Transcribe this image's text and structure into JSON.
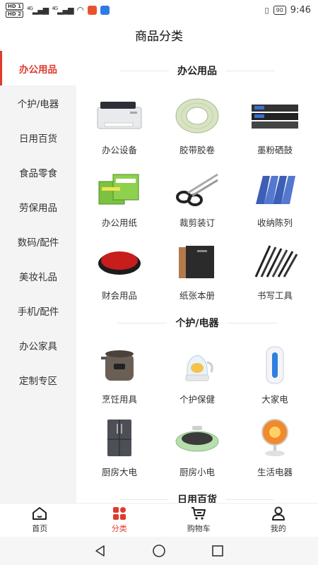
{
  "status": {
    "hd1": "HD 1",
    "hd2": "HD 2",
    "signal1": "4G",
    "signal2": "4G",
    "battery": "90",
    "time": "9:46"
  },
  "header": {
    "title": "商品分类"
  },
  "sidebar": {
    "items": [
      {
        "label": "办公用品"
      },
      {
        "label": "个护/电器"
      },
      {
        "label": "日用百货"
      },
      {
        "label": "食品零食"
      },
      {
        "label": "劳保用品"
      },
      {
        "label": "数码/配件"
      },
      {
        "label": "美妆礼品"
      },
      {
        "label": "手机/配件"
      },
      {
        "label": "办公家具"
      },
      {
        "label": "定制专区"
      }
    ]
  },
  "sections": [
    {
      "title": "办公用品",
      "items": [
        {
          "label": "办公设备",
          "icon": "printer-icon"
        },
        {
          "label": "胶带胶卷",
          "icon": "tape-icon"
        },
        {
          "label": "墨粉硒鼓",
          "icon": "toner-icon"
        },
        {
          "label": "办公用纸",
          "icon": "paper-pack-icon"
        },
        {
          "label": "裁剪装订",
          "icon": "scissors-icon"
        },
        {
          "label": "收纳陈列",
          "icon": "file-organizer-icon"
        },
        {
          "label": "财会用品",
          "icon": "ink-pad-icon"
        },
        {
          "label": "纸张本册",
          "icon": "notebook-icon"
        },
        {
          "label": "书写工具",
          "icon": "pens-icon"
        }
      ]
    },
    {
      "title": "个护/电器",
      "items": [
        {
          "label": "烹饪用具",
          "icon": "pressure-cooker-icon"
        },
        {
          "label": "个护保健",
          "icon": "kettle-icon"
        },
        {
          "label": "大家电",
          "icon": "air-purifier-icon"
        },
        {
          "label": "厨房大电",
          "icon": "fridge-icon"
        },
        {
          "label": "厨房小电",
          "icon": "grill-pan-icon"
        },
        {
          "label": "生活电器",
          "icon": "heater-icon"
        }
      ]
    },
    {
      "title": "日用百货",
      "items": []
    }
  ],
  "tabbar": {
    "tabs": [
      {
        "label": "首页",
        "icon": "home-icon"
      },
      {
        "label": "分类",
        "icon": "category-icon"
      },
      {
        "label": "购物车",
        "icon": "cart-icon"
      },
      {
        "label": "我的",
        "icon": "user-icon"
      }
    ]
  },
  "colors": {
    "accent": "#e03a2f",
    "sidebar_bg": "#f4f4f4"
  }
}
